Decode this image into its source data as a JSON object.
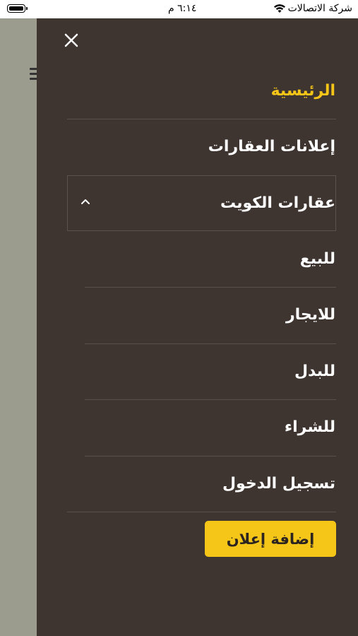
{
  "status_bar": {
    "carrier": "شركة الاتصالات",
    "time": "٦:١٤ م",
    "icons": [
      "wifi-icon",
      "battery-icon"
    ]
  },
  "menu": {
    "home": "الرئيسية",
    "property_ads": "إعلانات العقارات",
    "kuwait_properties": "عقارات الكويت",
    "submenu": {
      "for_sale": "للبيع",
      "for_rent": "للايجار",
      "for_exchange": "للبدل",
      "for_buy": "للشراء"
    },
    "login": "تسجيل الدخول",
    "add_ad_button": "إضافة إعلان"
  },
  "colors": {
    "drawer_bg": "#3e3430",
    "accent": "#f5c518",
    "backdrop": "#9c9c8e",
    "text": "#ffffff"
  }
}
